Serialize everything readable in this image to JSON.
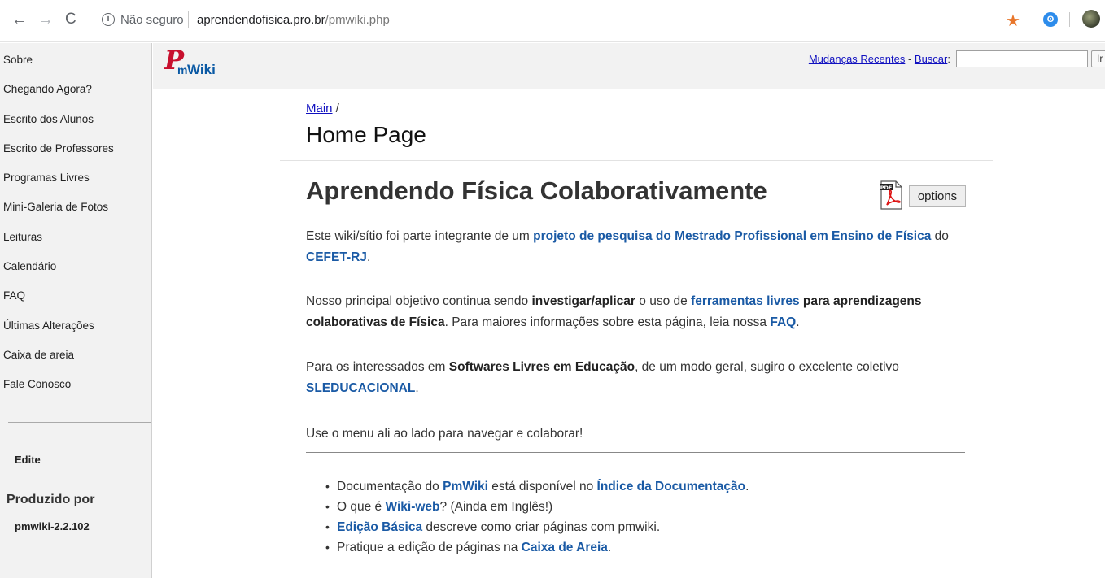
{
  "browser": {
    "back_icon": "←",
    "forward_icon": "→",
    "reload_icon": "C",
    "info_icon": "i",
    "security_label": "Não seguro",
    "url_domain": "aprendendofisica.pro.br",
    "url_path": "/pmwiki.php",
    "star_icon": "★",
    "extension_icon": "ʘ"
  },
  "sidebar": {
    "items": [
      {
        "label": "Sobre"
      },
      {
        "label": "Chegando Agora?"
      },
      {
        "label": "Escrito dos Alunos"
      },
      {
        "label": "Escrito de Professores"
      },
      {
        "label": "Programas Livres"
      },
      {
        "label": "Mini-Galeria de Fotos"
      },
      {
        "label": "Leituras"
      },
      {
        "label": "Calendário"
      },
      {
        "label": "FAQ"
      },
      {
        "label": "Últimas Alterações"
      },
      {
        "label": "Caixa de areia"
      },
      {
        "label": "Fale Conosco"
      }
    ],
    "edit_label": "Edite",
    "produced_by": "Produzido por",
    "version": "pmwiki-2.2.102"
  },
  "header": {
    "logo_p": "P",
    "logo_m": "m",
    "logo_wiki": "Wiki",
    "recent_changes": "Mudanças Recentes",
    "separator": " - ",
    "search_label": "Buscar",
    "search_colon": ":",
    "search_value": "",
    "go_button": "Ir"
  },
  "page": {
    "breadcrumb_link": "Main",
    "breadcrumb_sep": " /",
    "title": "Home Page",
    "heading": "Aprendendo Física Colaborativamente",
    "options_label": "options",
    "p1": {
      "t1": "Este wiki/sítio foi parte integrante de um ",
      "l1": "projeto de pesquisa do Mestrado Profissional em Ensino de Física",
      "t2": " do ",
      "l2": "CEFET-RJ",
      "t3": "."
    },
    "p2": {
      "t1": "Nosso principal objetivo continua sendo ",
      "b1": "investigar/aplicar",
      "t2": " o uso de ",
      "l1": "ferramentas livres",
      "t3": " ",
      "b2": "para aprendizagens colaborativas de Física",
      "t4": ". Para maiores informações sobre esta página, leia nossa ",
      "l2": "FAQ",
      "t5": "."
    },
    "p3": {
      "t1": "Para os interessados em ",
      "b1": "Softwares Livres em Educação",
      "t2": ", de um modo geral, sugiro o excelente coletivo ",
      "l1": "SLEDUCACIONAL",
      "t3": "."
    },
    "p4": "Use o menu ali ao lado para navegar e colaborar!",
    "bullets": [
      {
        "t1": "Documentação do ",
        "l1": "PmWiki",
        "t2": " está disponível no ",
        "l2": "Índice da Documentação",
        "t3": "."
      },
      {
        "t1": "O que é ",
        "l1": "Wiki-web",
        "t2": "? (Ainda em Inglês!)"
      },
      {
        "l1": "Edição Básica",
        "t2": " descreve como criar páginas com pmwiki."
      },
      {
        "t1": "Pratique a edição de páginas na ",
        "l1": "Caixa de Areia",
        "t2": "."
      }
    ]
  }
}
